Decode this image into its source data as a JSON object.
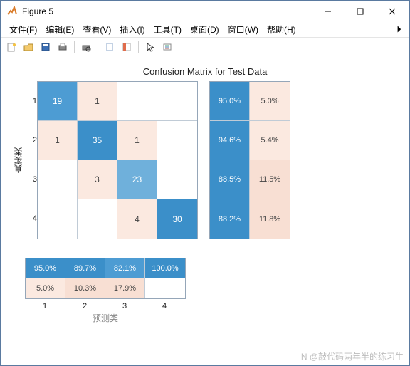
{
  "window": {
    "title": "Figure 5"
  },
  "menus": [
    "文件(F)",
    "编辑(E)",
    "查看(V)",
    "插入(I)",
    "工具(T)",
    "桌面(D)",
    "窗口(W)",
    "帮助(H)"
  ],
  "toolbar_icons": [
    "new",
    "open",
    "save",
    "print",
    "|",
    "print-preview",
    "|",
    "link",
    "datatip",
    "|",
    "pointer",
    "legend"
  ],
  "chart_data": {
    "type": "heatmap",
    "title": "Confusion Matrix for Test Data",
    "xlabel": "预测类",
    "ylabel": "真实类",
    "categories": [
      "1",
      "2",
      "3",
      "4"
    ],
    "matrix": [
      [
        19,
        1,
        null,
        null
      ],
      [
        1,
        35,
        1,
        null
      ],
      [
        null,
        3,
        23,
        null
      ],
      [
        null,
        null,
        4,
        30
      ]
    ],
    "row_summary": [
      {
        "correct": "95.0%",
        "incorrect": "5.0%"
      },
      {
        "correct": "94.6%",
        "incorrect": "5.4%"
      },
      {
        "correct": "88.5%",
        "incorrect": "11.5%"
      },
      {
        "correct": "88.2%",
        "incorrect": "11.8%"
      }
    ],
    "col_summary": [
      {
        "correct": "95.0%",
        "incorrect": "5.0%"
      },
      {
        "correct": "89.7%",
        "incorrect": "10.3%"
      },
      {
        "correct": "82.1%",
        "incorrect": "17.9%"
      },
      {
        "correct": "100.0%",
        "incorrect": ""
      }
    ]
  },
  "watermark": "N @敲代码两年半的练习生"
}
